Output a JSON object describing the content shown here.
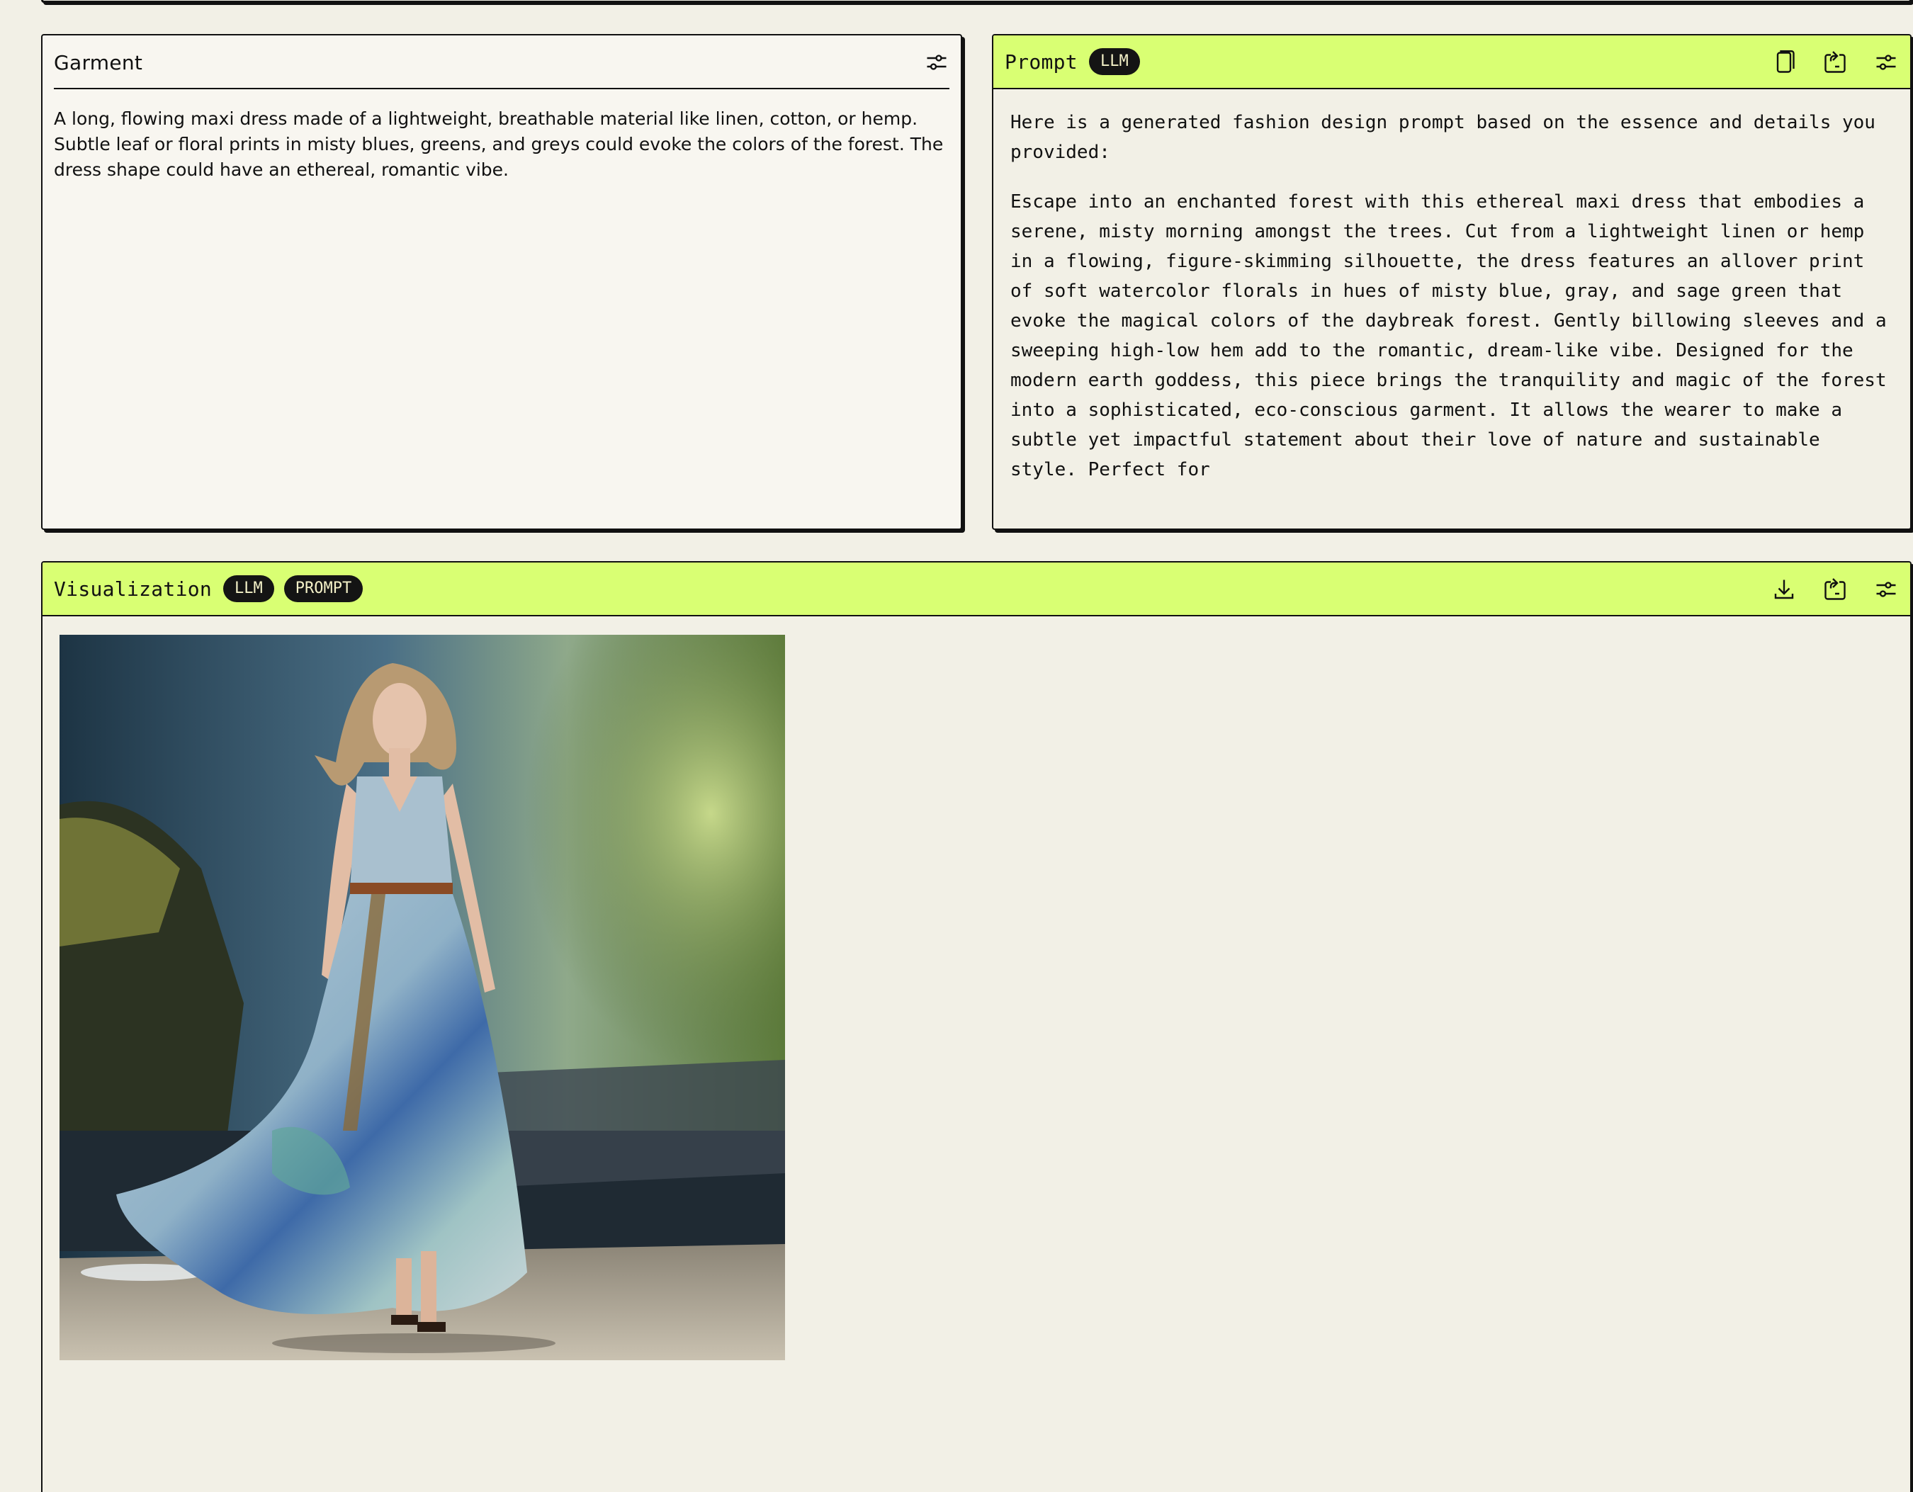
{
  "garment": {
    "title": "Garment",
    "text": "A long, flowing maxi dress made of a lightweight, breathable material like linen, cotton, or hemp. Subtle leaf or floral prints in misty blues, greens, and greys could evoke the colors of the forest. The dress shape could have an ethereal, romantic vibe.",
    "icons": [
      "settings-sliders-icon"
    ]
  },
  "prompt": {
    "title": "Prompt",
    "badge": "LLM",
    "intro": "Here is a generated fashion design prompt based on the essence and details you provided:",
    "body": "Escape into an enchanted forest with this ethereal maxi dress that embodies a serene, misty morning amongst the trees. Cut from a lightweight linen or hemp in a flowing, figure-skimming silhouette, the dress features an allover print of soft watercolor florals in hues of misty blue, gray, and sage green that evoke the magical colors of the daybreak forest. Gently billowing sleeves and a sweeping high-low hem add to the romantic, dream-like vibe. Designed for the modern earth goddess, this piece brings the tranquility and magic of the forest into a sophisticated, eco-conscious garment. It allows the wearer to make a subtle yet impactful statement about their love of nature and sustainable style. Perfect for",
    "icons": [
      "copy-icon",
      "share-icon",
      "settings-sliders-icon"
    ]
  },
  "visualization": {
    "title": "Visualization",
    "badges": [
      "LLM",
      "PROMPT"
    ],
    "icons": [
      "download-icon",
      "share-icon",
      "settings-sliders-icon"
    ]
  },
  "colors": {
    "background": "#f2f0e6",
    "accent": "#d9ff73",
    "badge": "#141414"
  }
}
